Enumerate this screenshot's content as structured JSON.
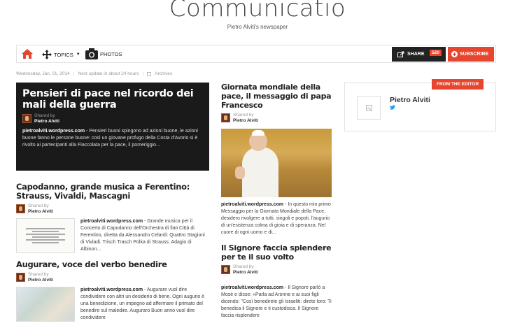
{
  "masthead": {
    "title": "Communicatio",
    "tagline": "Pietro Alviti's newspaper"
  },
  "navbar": {
    "home_icon": "home-icon",
    "topics_label": "TOPICS",
    "topics_icon": "move-arrows-icon",
    "photos_label": "PHOTOS",
    "photos_icon": "camera-icon",
    "share_label": "SHARE",
    "share_count": "520",
    "subscribe_label": "SUBSCRIBE"
  },
  "infobar": {
    "date": "Wednesday, Jan. 01, 2014",
    "next_update": "Next update in about 24 hours",
    "archives": "Archives"
  },
  "colors": {
    "accent": "#e8452f",
    "dark": "#1a1a1a",
    "twitter": "#1da1f2"
  },
  "featured": {
    "headline": "Pensieri di pace nel ricordo dei mali della guerra",
    "shared_by_label": "Shared by",
    "author": "Pietro Alviti",
    "source": "pietroalviti.wordpress.com",
    "excerpt": " - Pensieri buoni spingono ad azioni buone, le azioni buone fanno le persone buone: così un giovane profugo della Costa d'Avorio si è rivolto ai partecipanti alla Fiaccolata per la pace, il pomeriggio..."
  },
  "articles_left": [
    {
      "headline": "Capodanno, grande musica a Ferentino: Strauss, Vivaldi, Mascagni",
      "shared_by_label": "Shared by",
      "author": "Pietro Alviti",
      "source": "pietroalviti.wordpress.com",
      "excerpt": " - Grande musica per il Concerto di Capodanno dell'Orchestra di fiati Città di Ferentino, diretta da Alessandro Celardi: Quattro Stagioni di Vivladi. Trisch Trasch Polka di Strauss. Adagio di Albinon..."
    },
    {
      "headline": "Augurare, voce del verbo benedire",
      "shared_by_label": "Shared by",
      "author": "Pietro Alviti",
      "source": "pietroalviti.wordpress.com",
      "excerpt": " - Augurare vuol dire condividere con altri un desiderio di bene. Ogni augurio è una benedizione, un impegno ad affermare il primato del benedire sul maledire. Auguraro Buon anno vuol dire condividere"
    }
  ],
  "articles_mid": [
    {
      "headline": "Giornata mondiale della pace, il messaggio di papa Francesco",
      "shared_by_label": "Shared by",
      "author": "Pietro Alviti",
      "source": "pietroalviti.wordpress.com",
      "excerpt": " - In questo mio primo Messaggio per la Giornata Mondiale della Pace, desidero rivolgere a tutti, singoli e popoli, l'augurio di un'esistenza colma di gioia e di speranza. Nel cuore di ogni uomo e di..."
    },
    {
      "headline": "Il Signore faccia splendere per te il suo volto",
      "shared_by_label": "Shared by",
      "author": "Pietro Alviti",
      "source": "pietroalviti.wordpress.com",
      "excerpt": " - Il Signore parlò a Mosè e disse: «Parla ad Aronne e ai suoi figli dicendo: \"Così benedirete gli Israeliti: direte loro: Ti benedica il Signore e ti custodisca. Il Signore faccia risplendere"
    }
  ],
  "editor": {
    "tag": "FROM THE EDITOR",
    "name": "Pietro Alviti",
    "twitter_icon": "twitter-icon"
  }
}
